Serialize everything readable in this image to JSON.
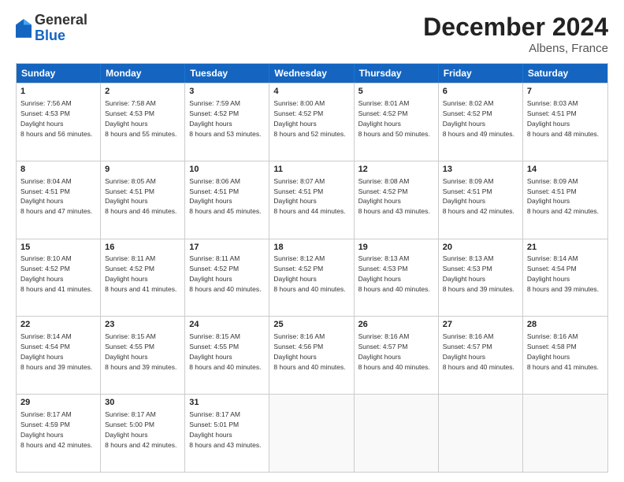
{
  "header": {
    "logo_general": "General",
    "logo_blue": "Blue",
    "title": "December 2024",
    "subtitle": "Albens, France"
  },
  "days": [
    "Sunday",
    "Monday",
    "Tuesday",
    "Wednesday",
    "Thursday",
    "Friday",
    "Saturday"
  ],
  "weeks": [
    [
      {
        "day": "1",
        "sunrise": "7:56 AM",
        "sunset": "4:53 PM",
        "daylight": "8 hours and 56 minutes."
      },
      {
        "day": "2",
        "sunrise": "7:58 AM",
        "sunset": "4:53 PM",
        "daylight": "8 hours and 55 minutes."
      },
      {
        "day": "3",
        "sunrise": "7:59 AM",
        "sunset": "4:52 PM",
        "daylight": "8 hours and 53 minutes."
      },
      {
        "day": "4",
        "sunrise": "8:00 AM",
        "sunset": "4:52 PM",
        "daylight": "8 hours and 52 minutes."
      },
      {
        "day": "5",
        "sunrise": "8:01 AM",
        "sunset": "4:52 PM",
        "daylight": "8 hours and 50 minutes."
      },
      {
        "day": "6",
        "sunrise": "8:02 AM",
        "sunset": "4:52 PM",
        "daylight": "8 hours and 49 minutes."
      },
      {
        "day": "7",
        "sunrise": "8:03 AM",
        "sunset": "4:51 PM",
        "daylight": "8 hours and 48 minutes."
      }
    ],
    [
      {
        "day": "8",
        "sunrise": "8:04 AM",
        "sunset": "4:51 PM",
        "daylight": "8 hours and 47 minutes."
      },
      {
        "day": "9",
        "sunrise": "8:05 AM",
        "sunset": "4:51 PM",
        "daylight": "8 hours and 46 minutes."
      },
      {
        "day": "10",
        "sunrise": "8:06 AM",
        "sunset": "4:51 PM",
        "daylight": "8 hours and 45 minutes."
      },
      {
        "day": "11",
        "sunrise": "8:07 AM",
        "sunset": "4:51 PM",
        "daylight": "8 hours and 44 minutes."
      },
      {
        "day": "12",
        "sunrise": "8:08 AM",
        "sunset": "4:52 PM",
        "daylight": "8 hours and 43 minutes."
      },
      {
        "day": "13",
        "sunrise": "8:09 AM",
        "sunset": "4:51 PM",
        "daylight": "8 hours and 42 minutes."
      },
      {
        "day": "14",
        "sunrise": "8:09 AM",
        "sunset": "4:51 PM",
        "daylight": "8 hours and 42 minutes."
      }
    ],
    [
      {
        "day": "15",
        "sunrise": "8:10 AM",
        "sunset": "4:52 PM",
        "daylight": "8 hours and 41 minutes."
      },
      {
        "day": "16",
        "sunrise": "8:11 AM",
        "sunset": "4:52 PM",
        "daylight": "8 hours and 41 minutes."
      },
      {
        "day": "17",
        "sunrise": "8:11 AM",
        "sunset": "4:52 PM",
        "daylight": "8 hours and 40 minutes."
      },
      {
        "day": "18",
        "sunrise": "8:12 AM",
        "sunset": "4:52 PM",
        "daylight": "8 hours and 40 minutes."
      },
      {
        "day": "19",
        "sunrise": "8:13 AM",
        "sunset": "4:53 PM",
        "daylight": "8 hours and 40 minutes."
      },
      {
        "day": "20",
        "sunrise": "8:13 AM",
        "sunset": "4:53 PM",
        "daylight": "8 hours and 39 minutes."
      },
      {
        "day": "21",
        "sunrise": "8:14 AM",
        "sunset": "4:54 PM",
        "daylight": "8 hours and 39 minutes."
      }
    ],
    [
      {
        "day": "22",
        "sunrise": "8:14 AM",
        "sunset": "4:54 PM",
        "daylight": "8 hours and 39 minutes."
      },
      {
        "day": "23",
        "sunrise": "8:15 AM",
        "sunset": "4:55 PM",
        "daylight": "8 hours and 39 minutes."
      },
      {
        "day": "24",
        "sunrise": "8:15 AM",
        "sunset": "4:55 PM",
        "daylight": "8 hours and 40 minutes."
      },
      {
        "day": "25",
        "sunrise": "8:16 AM",
        "sunset": "4:56 PM",
        "daylight": "8 hours and 40 minutes."
      },
      {
        "day": "26",
        "sunrise": "8:16 AM",
        "sunset": "4:57 PM",
        "daylight": "8 hours and 40 minutes."
      },
      {
        "day": "27",
        "sunrise": "8:16 AM",
        "sunset": "4:57 PM",
        "daylight": "8 hours and 40 minutes."
      },
      {
        "day": "28",
        "sunrise": "8:16 AM",
        "sunset": "4:58 PM",
        "daylight": "8 hours and 41 minutes."
      }
    ],
    [
      {
        "day": "29",
        "sunrise": "8:17 AM",
        "sunset": "4:59 PM",
        "daylight": "8 hours and 42 minutes."
      },
      {
        "day": "30",
        "sunrise": "8:17 AM",
        "sunset": "5:00 PM",
        "daylight": "8 hours and 42 minutes."
      },
      {
        "day": "31",
        "sunrise": "8:17 AM",
        "sunset": "5:01 PM",
        "daylight": "8 hours and 43 minutes."
      },
      null,
      null,
      null,
      null
    ]
  ]
}
